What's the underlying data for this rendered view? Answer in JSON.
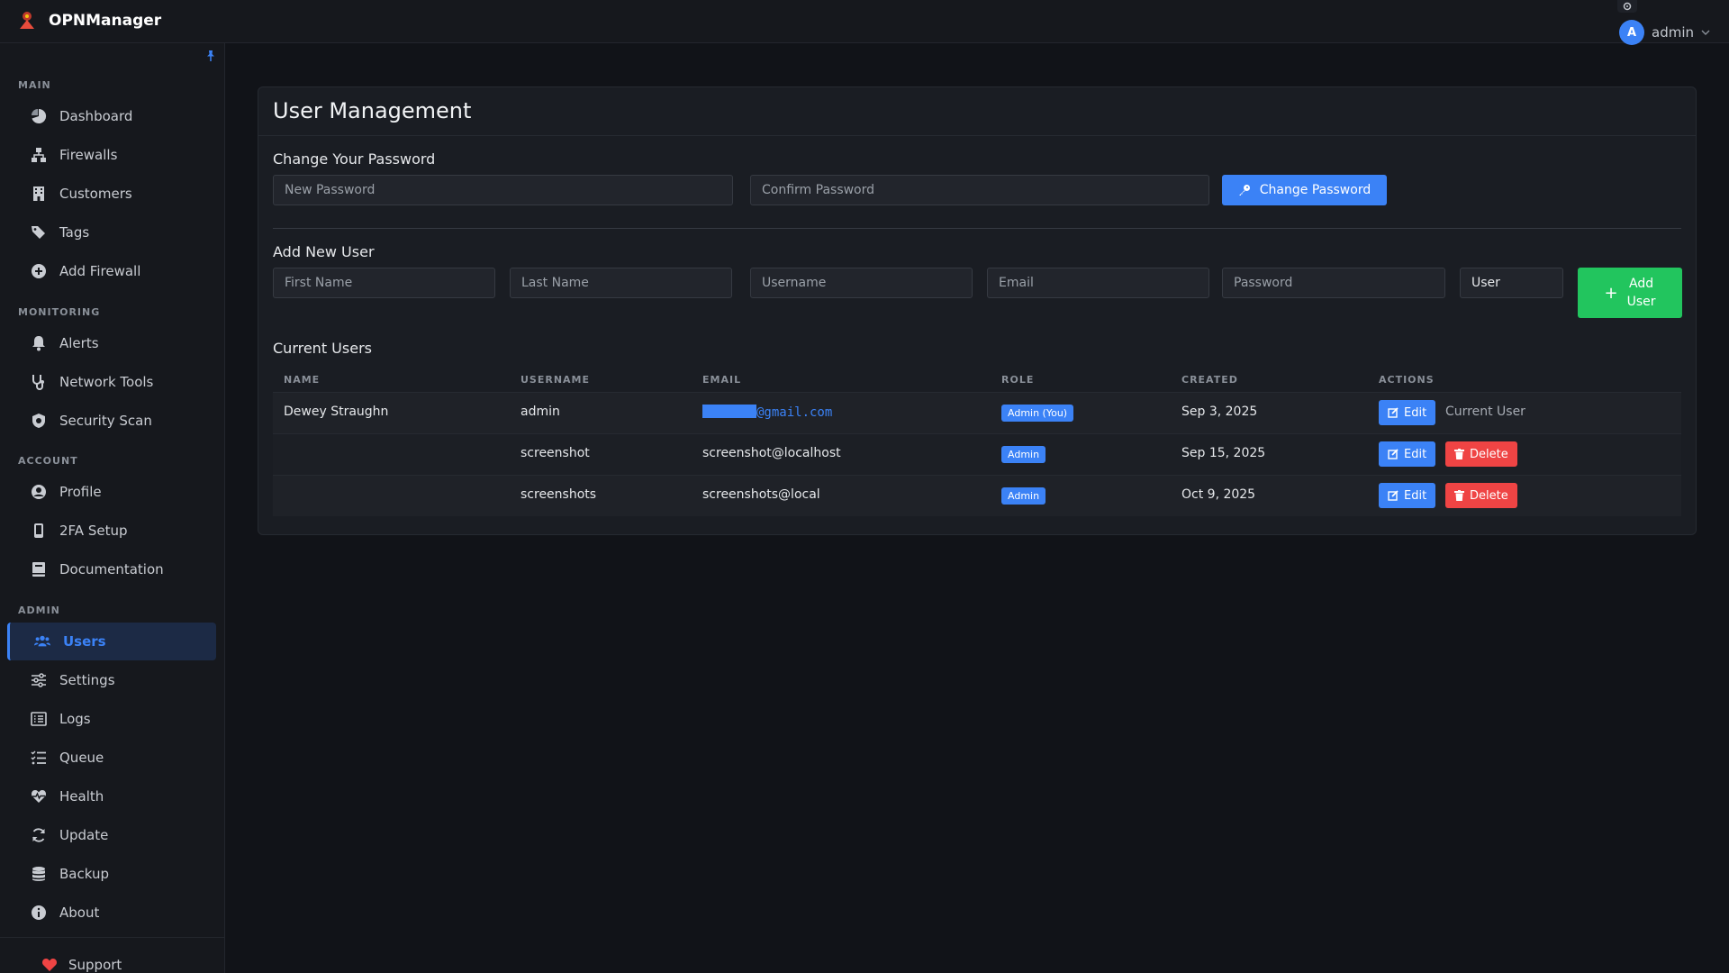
{
  "app": {
    "name": "OPNManager"
  },
  "user_menu": {
    "avatar_letter": "A",
    "name": "admin"
  },
  "sidebar": {
    "sections": {
      "main": "MAIN",
      "monitoring": "MONITORING",
      "account": "ACCOUNT",
      "admin": "ADMIN"
    },
    "items": {
      "dashboard": "Dashboard",
      "firewalls": "Firewalls",
      "customers": "Customers",
      "tags": "Tags",
      "add_firewall": "Add Firewall",
      "alerts": "Alerts",
      "network_tools": "Network Tools",
      "security_scan": "Security Scan",
      "profile": "Profile",
      "twofa": "2FA Setup",
      "documentation": "Documentation",
      "users": "Users",
      "settings": "Settings",
      "logs": "Logs",
      "queue": "Queue",
      "health": "Health",
      "update": "Update",
      "backup": "Backup",
      "about": "About"
    },
    "support": "Support"
  },
  "page": {
    "title": "User Management",
    "change_password": {
      "heading": "Change Your Password",
      "new_placeholder": "New Password",
      "confirm_placeholder": "Confirm Password",
      "button": "Change Password"
    },
    "add_user": {
      "heading": "Add New User",
      "first_name_placeholder": "First Name",
      "last_name_placeholder": "Last Name",
      "username_placeholder": "Username",
      "email_placeholder": "Email",
      "password_placeholder": "Password",
      "role_value": "User",
      "button_line1": "Add",
      "button_line2": "User"
    },
    "users_table": {
      "heading": "Current Users",
      "columns": [
        "NAME",
        "USERNAME",
        "EMAIL",
        "ROLE",
        "CREATED",
        "ACTIONS"
      ],
      "rows": [
        {
          "name": "Dewey Straughn",
          "username": "admin",
          "email_domain": "@gmail.com",
          "role": "Admin (You)",
          "created": "Sep 3, 2025",
          "edit": "Edit",
          "extra": "Current User"
        },
        {
          "name": "",
          "username": "screenshot",
          "email": "screenshot@localhost",
          "role": "Admin",
          "created": "Sep 15, 2025",
          "edit": "Edit",
          "delete": "Delete"
        },
        {
          "name": "",
          "username": "screenshots",
          "email": "screenshots@local",
          "role": "Admin",
          "created": "Oct 9, 2025",
          "edit": "Edit",
          "delete": "Delete"
        }
      ]
    }
  },
  "colors": {
    "accent": "#3b82f6",
    "success": "#22c55e",
    "danger": "#ef4444",
    "background": "#111318"
  }
}
